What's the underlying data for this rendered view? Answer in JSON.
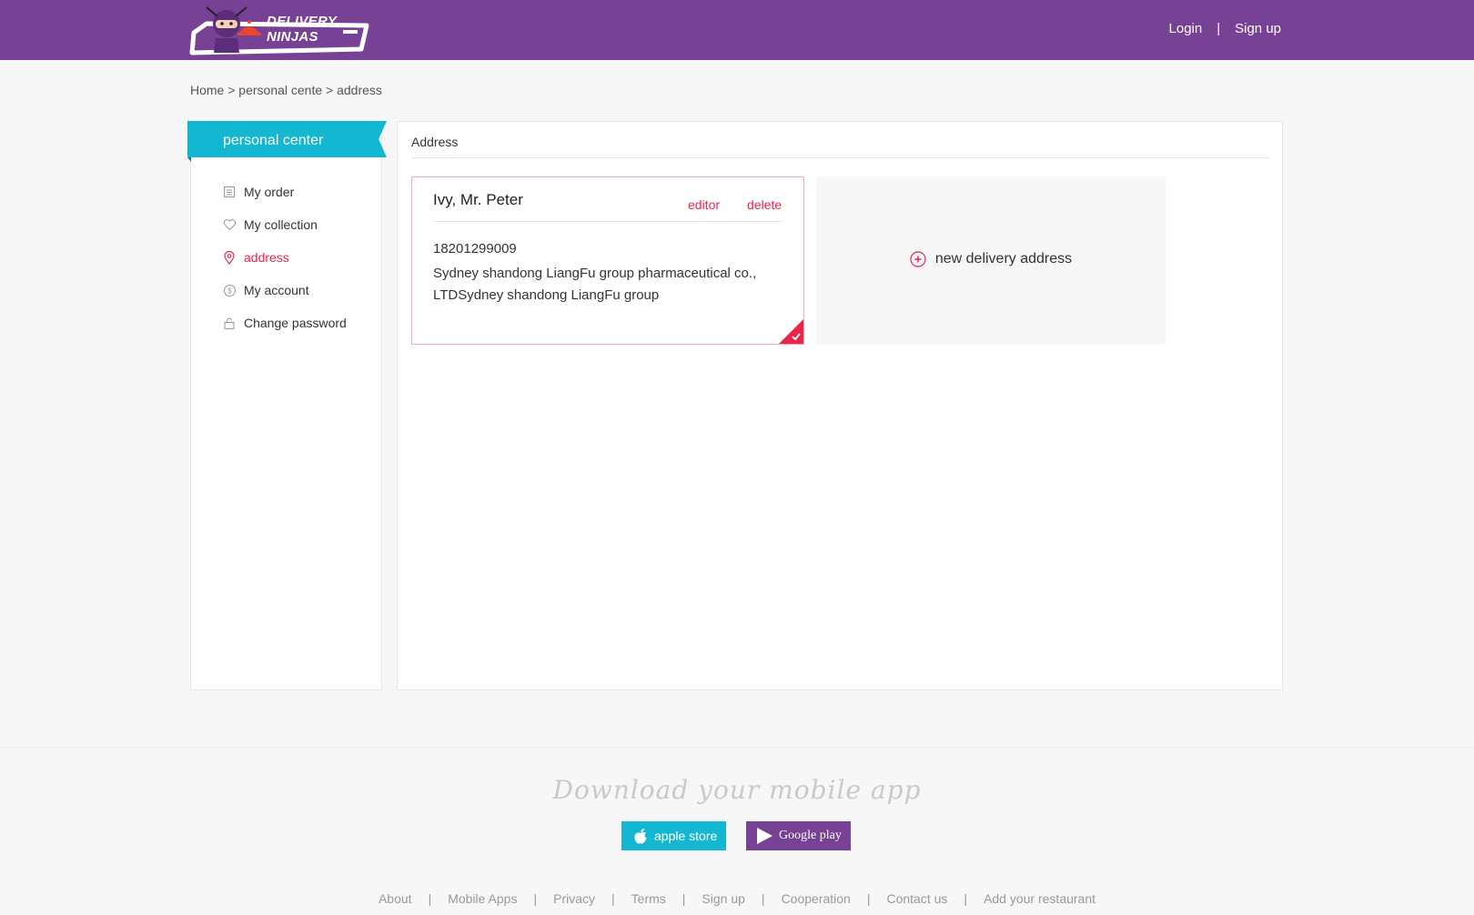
{
  "brand": {
    "name": "DELIVERY NINJAS",
    "primary_color": "#774195",
    "accent_color": "#13b7d2",
    "highlight_color": "#e8254b"
  },
  "header": {
    "login": "Login",
    "separator": "|",
    "signup": "Sign up"
  },
  "breadcrumb": "Home > personal cente > address",
  "sidebar": {
    "title": "personal center",
    "items": [
      {
        "label": "My order",
        "icon": "order-list-icon",
        "active": false
      },
      {
        "label": "My collection",
        "icon": "heart-icon",
        "active": false
      },
      {
        "label": "address",
        "icon": "location-pin-icon",
        "active": true
      },
      {
        "label": "My account",
        "icon": "dollar-coin-icon",
        "active": false
      },
      {
        "label": "Change password",
        "icon": "lock-icon",
        "active": false
      }
    ]
  },
  "main": {
    "title": "Address",
    "address_card": {
      "name": "Ivy, Mr. Peter",
      "edit_label": "editor",
      "delete_label": "delete",
      "phone": "18201299009",
      "address": "Sydney shandong LiangFu group pharmaceutical co., LTDSydney shandong LiangFu group",
      "selected": true
    },
    "new_address_label": "new delivery address"
  },
  "footer": {
    "download_title": "Download your mobile app",
    "apple_label": "apple store",
    "google_label": "Google play",
    "links": [
      "About",
      "Mobile Apps",
      "Privacy",
      "Terms",
      "Sign up",
      "Cooperation",
      "Contact us",
      "Add your restaurant"
    ],
    "link_separator": "|"
  }
}
